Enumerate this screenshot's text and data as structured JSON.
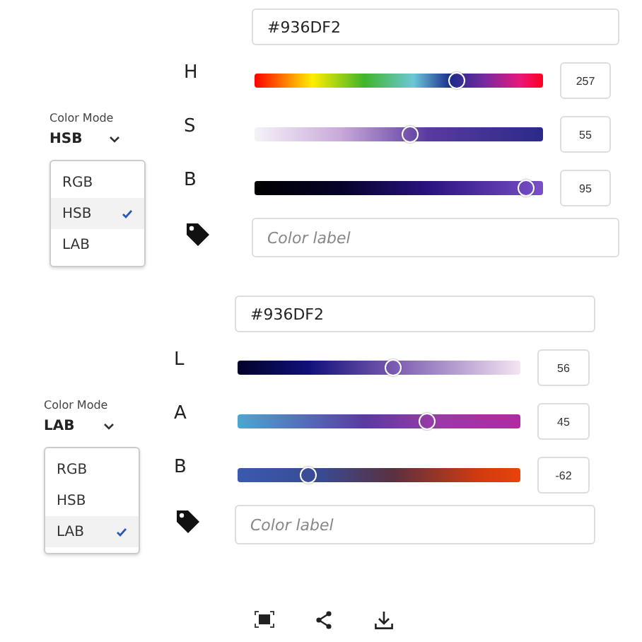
{
  "panels": [
    {
      "color_mode_label": "Color Mode",
      "mode": "HSB",
      "options": [
        {
          "label": "RGB",
          "selected": false
        },
        {
          "label": "HSB",
          "selected": true
        },
        {
          "label": "LAB",
          "selected": false
        }
      ],
      "hex": "#936DF2",
      "sliders": [
        {
          "name": "H",
          "level": 0.7,
          "value": "257"
        },
        {
          "name": "S",
          "level": 0.54,
          "value": "55"
        },
        {
          "name": "B",
          "level": 0.94,
          "value": "95"
        }
      ],
      "label_placeholder": "Color label"
    },
    {
      "color_mode_label": "Color Mode",
      "mode": "LAB",
      "options": [
        {
          "label": "RGB",
          "selected": false
        },
        {
          "label": "HSB",
          "selected": false
        },
        {
          "label": "LAB",
          "selected": true
        }
      ],
      "hex": "#936DF2",
      "sliders": [
        {
          "name": "L",
          "level": 0.55,
          "value": "56"
        },
        {
          "name": "A",
          "level": 0.67,
          "value": "45"
        },
        {
          "name": "B",
          "level": 0.25,
          "value": "-62"
        }
      ],
      "label_placeholder": "Color label"
    }
  ]
}
